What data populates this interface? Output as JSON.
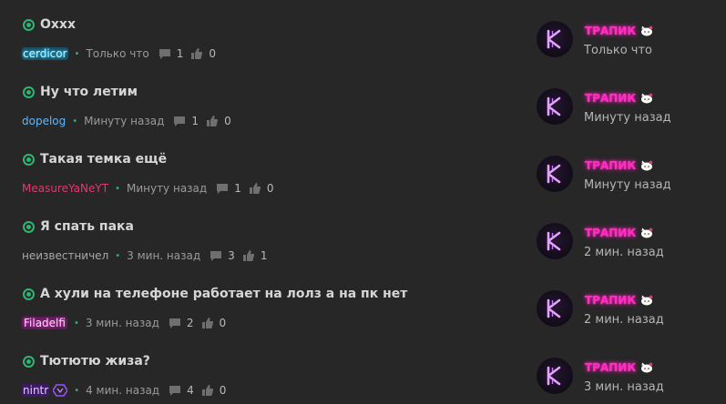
{
  "threads": [
    {
      "title": "Oxxx",
      "author": "cerdicor",
      "time": "Только что",
      "replies": "1",
      "likes": "0",
      "last_poster": "ТРАПИК",
      "last_time": "Только что"
    },
    {
      "title": "Ну что летим",
      "author": "dopelog",
      "time": "Минуту назад",
      "replies": "1",
      "likes": "0",
      "last_poster": "ТРАПИК",
      "last_time": "Минуту назад"
    },
    {
      "title": "Такая темка ещё",
      "author": "MeasureYaNeYT",
      "time": "Минуту назад",
      "replies": "1",
      "likes": "0",
      "last_poster": "ТРАПИК",
      "last_time": "Минуту назад"
    },
    {
      "title": "Я спать пака",
      "author": "неизвестничел",
      "time": "3 мин. назад",
      "replies": "3",
      "likes": "1",
      "last_poster": "ТРАПИК",
      "last_time": "2 мин. назад"
    },
    {
      "title": "А хули на телефоне работает на лолз а на пк нет",
      "author": "Filadelfi",
      "time": "3 мин. назад",
      "replies": "2",
      "likes": "0",
      "last_poster": "ТРАПИК",
      "last_time": "2 мин. назад"
    },
    {
      "title": "Тютютю жиза?",
      "author": "nintr",
      "time": "4 мин. назад",
      "replies": "4",
      "likes": "0",
      "last_poster": "ТРАПИК",
      "last_time": "3 мин. назад"
    }
  ],
  "colors": {
    "background": "#272727",
    "unread_status": "#2bb673",
    "last_poster_name": "#ff2fc4"
  },
  "icons": {
    "status": "unread-circle-icon",
    "replies": "comment-icon",
    "likes": "thumbs-up-icon",
    "last_poster_badge": "hello-kitty-icon",
    "author_badge": "purple-hexagon-icon"
  }
}
